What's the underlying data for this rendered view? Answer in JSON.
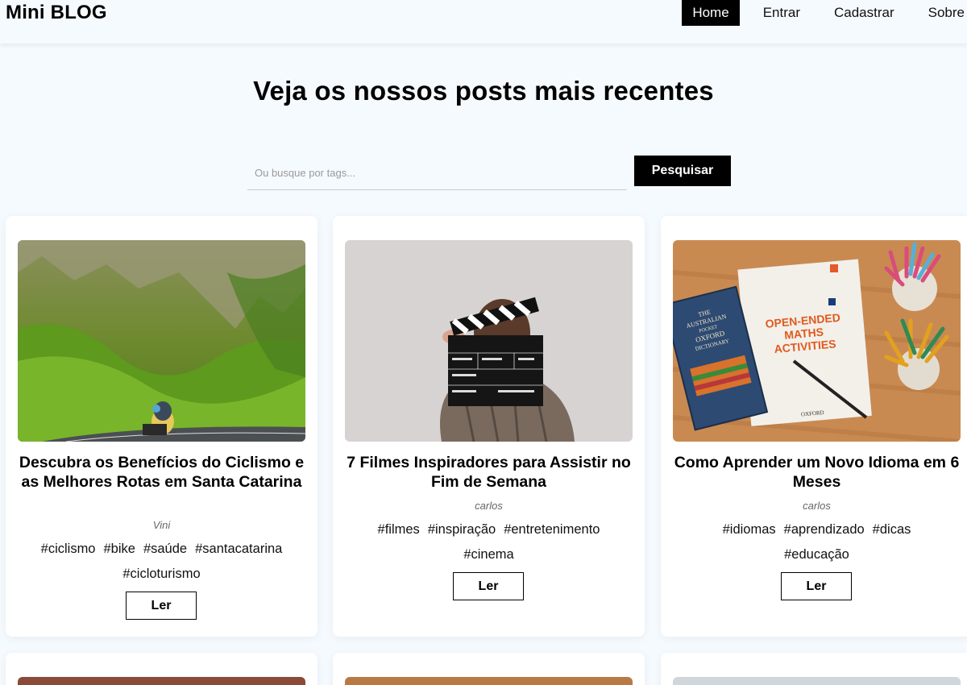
{
  "navbar": {
    "brand": "Mini BLOG",
    "links": [
      "Home",
      "Entrar",
      "Cadastrar",
      "Sobre"
    ],
    "active_link": "Home"
  },
  "page_title": "Veja os nossos posts mais recentes",
  "search": {
    "placeholder": "Ou busque por tags...",
    "value": "",
    "button_label": "Pesquisar"
  },
  "posts": [
    {
      "title": "Descubra os Benefícios do Ciclismo e as Melhores Rotas em Santa Catarina",
      "author": "Vini",
      "tags": [
        "#ciclismo",
        "#bike",
        "#saúde",
        "#santacatarina",
        "#cicloturismo"
      ],
      "read_label": "Ler",
      "image": "cyclist-on-mountain-road"
    },
    {
      "title": "7 Filmes Inspiradores para Assistir no Fim de Semana",
      "author": "carlos",
      "tags": [
        "#filmes",
        "#inspiração",
        "#entretenimento",
        "#cinema"
      ],
      "read_label": "Ler",
      "image": "person-with-clapperboard"
    },
    {
      "title": "Como Aprender um Novo Idioma em 6 Meses",
      "author": "carlos",
      "tags": [
        "#idiomas",
        "#aprendizado",
        "#dicas",
        "#educação"
      ],
      "read_label": "Ler",
      "image": "books-and-pencils",
      "image_text": {
        "book1_line1": "THE",
        "book1_line2": "AUSTRALIAN",
        "book1_line3": "POCKET",
        "book1_line4": "OXFORD",
        "book1_line5": "DICTIONARY",
        "book2_line1": "OPEN-ENDED",
        "book2_line2": "MATHS",
        "book2_line3": "ACTIVITIES",
        "book2_footer": "OXFORD"
      }
    }
  ],
  "colors": {
    "page_background": "#f5faff",
    "primary": "#000000",
    "card_background": "#ffffff"
  }
}
